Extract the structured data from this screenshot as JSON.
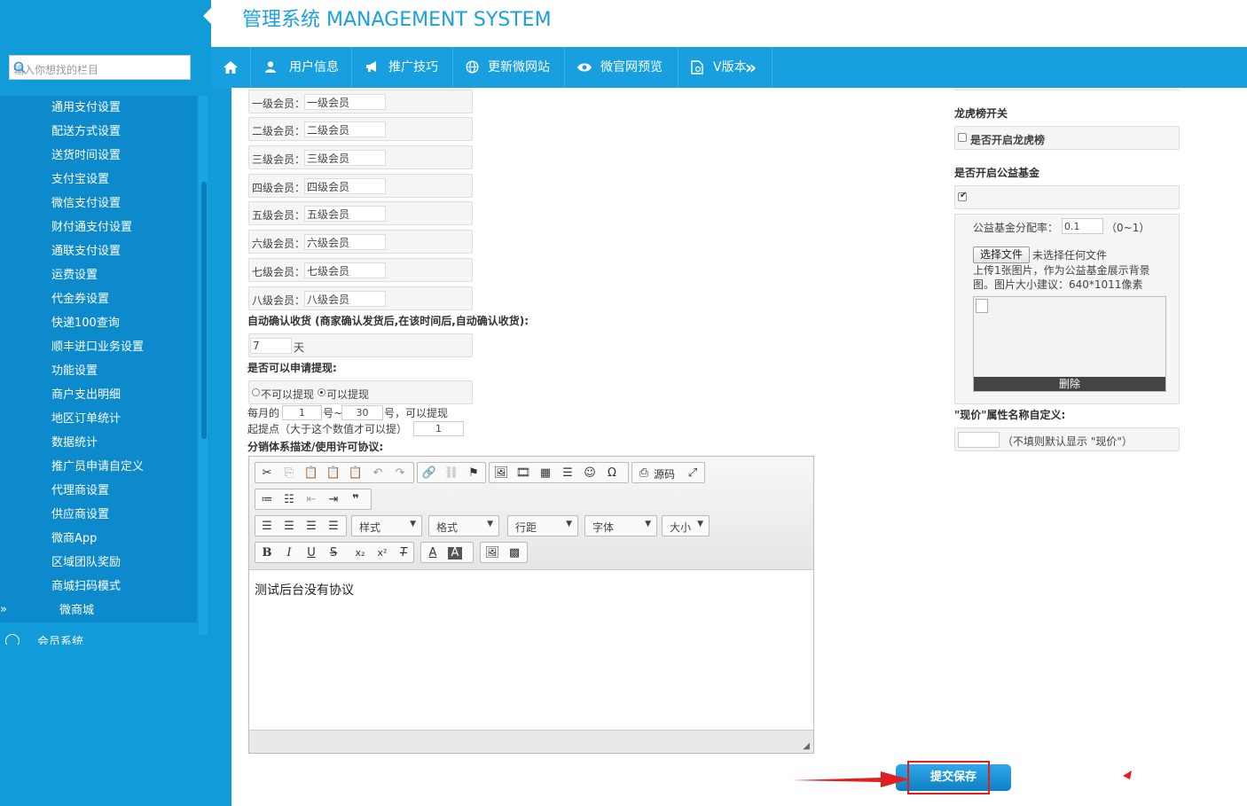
{
  "app": {
    "title": "管理系统 MANAGEMENT SYSTEM"
  },
  "search": {
    "placeholder": "输入你想找的栏目"
  },
  "sidebar": {
    "items": [
      "通用支付设置",
      "配送方式设置",
      "送货时间设置",
      "支付宝设置",
      "微信支付设置",
      "财付通支付设置",
      "通联支付设置",
      "运费设置",
      "代金券设置",
      "快递100查询",
      "顺丰进口业务设置",
      "功能设置",
      "商户支出明细",
      "地区订单统计",
      "数据统计",
      "推广员申请自定义",
      "代理商设置",
      "供应商设置",
      "微商App",
      "区域团队奖励",
      "商城扫码模式"
    ],
    "active_item": "微商城",
    "arrow": "»",
    "next_section": "会员系统"
  },
  "topnav": {
    "items": [
      "用户信息",
      "推广技巧",
      "更新微网站",
      "微官网预览",
      "V版本"
    ],
    "more": "»"
  },
  "form": {
    "member_levels": [
      {
        "label": "一级会员：",
        "value": "一级会员"
      },
      {
        "label": "二级会员：",
        "value": "二级会员"
      },
      {
        "label": "三级会员：",
        "value": "三级会员"
      },
      {
        "label": "四级会员：",
        "value": "四级会员"
      },
      {
        "label": "五级会员：",
        "value": "五级会员"
      },
      {
        "label": "六级会员：",
        "value": "六级会员"
      },
      {
        "label": "七级会员：",
        "value": "七级会员"
      },
      {
        "label": "八级会员：",
        "value": "八级会员"
      }
    ],
    "auto_confirm": {
      "heading": "自动确认收货 (商家确认发货后,在该时间后,自动确认收货):",
      "value": "7",
      "unit": "天"
    },
    "withdraw": {
      "heading": "是否可以申请提现:",
      "option_no": "不可以提现",
      "option_yes": "可以提现",
      "selected": "可以提现",
      "monthly_prefix": "每月的",
      "from_day": "1",
      "mid": "号~",
      "to_day": "30",
      "suffix": "号，可以提现",
      "threshold_label": "起提点（大于这个数值才可以提）",
      "threshold_value": "1"
    },
    "agreement": {
      "heading": "分销体系描述/使用许可协议:",
      "content": "测试后台没有协议"
    }
  },
  "editor": {
    "source_label": "源码",
    "combos": [
      "样式",
      "格式",
      "行距",
      "字体",
      "大小"
    ],
    "bold": "B",
    "italic": "I",
    "underline": "U",
    "strike": "S"
  },
  "right": {
    "dragon": {
      "heading": "龙虎榜开关",
      "checkbox_label": "是否开启龙虎榜",
      "checked": false
    },
    "charity": {
      "heading": "是否开启公益基金",
      "checked": true,
      "ratio_label": "公益基金分配率：",
      "ratio_value": "0.1",
      "ratio_hint": "（0~1）",
      "choose_file": "选择文件",
      "no_file": "未选择任何文件",
      "upload_hint": "上传1张图片，作为公益基金展示背景图。图片大小建议：640*1011像素",
      "delete": "删除"
    },
    "price_name": {
      "heading": "\"现价\"属性名称自定义:",
      "value": "",
      "hint": "（不填则默认显示 \"现价\"）"
    }
  },
  "actions": {
    "submit": "提交保存"
  },
  "colors": {
    "primary": "#129bd9",
    "topbar": "#189fe0",
    "menu": "#0d8acb",
    "annotation": "#e02020"
  }
}
